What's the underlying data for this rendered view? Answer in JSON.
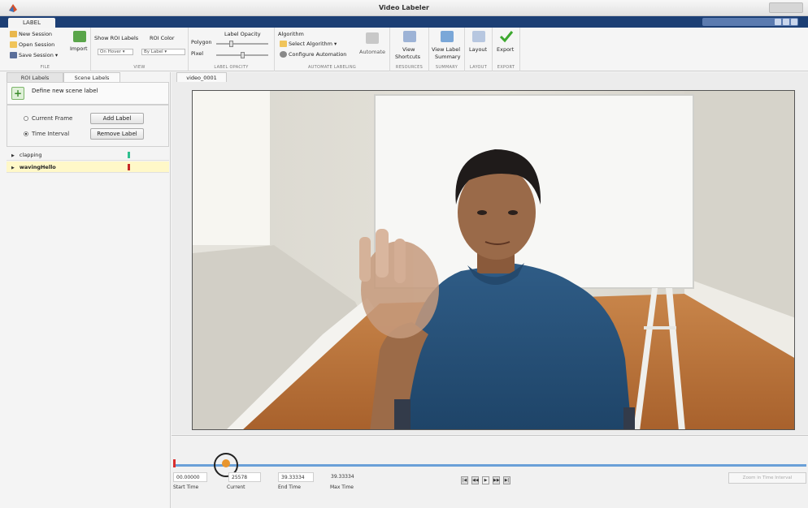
{
  "window": {
    "title": "Video Labeler"
  },
  "tabs": [
    {
      "label": "LABEL"
    }
  ],
  "ribbon": {
    "file": {
      "footer": "FILE",
      "new_session": "New Session",
      "open_session": "Open Session",
      "save_session": "Save Session ▾",
      "import": "Import"
    },
    "view": {
      "footer": "VIEW",
      "show_roi_labels": "Show ROI Labels",
      "show_roi_labels_value": "On Hover ▾",
      "roi_color": "ROI Color",
      "roi_color_value": "By Label ▾"
    },
    "opacity": {
      "footer": "LABEL OPACITY",
      "title": "Label Opacity",
      "polygon": "Polygon",
      "pixel": "Pixel"
    },
    "automate": {
      "footer": "AUTOMATE LABELING",
      "algorithm": "Algorithm",
      "select_algorithm": "Select Algorithm ▾",
      "configure": "Configure Automation",
      "automate": "Automate"
    },
    "resources": {
      "footer": "RESOURCES",
      "view_shortcuts_1": "View",
      "view_shortcuts_2": "Shortcuts"
    },
    "summary": {
      "footer": "SUMMARY",
      "view_label_1": "View Label",
      "view_label_2": "Summary"
    },
    "layout": {
      "footer": "LAYOUT",
      "label": "Layout"
    },
    "export": {
      "footer": "EXPORT",
      "label": "Export"
    }
  },
  "left_panel": {
    "tabs": [
      "ROI Labels",
      "Scene Labels"
    ],
    "define_label": "Define new scene label",
    "current_frame": "Current Frame",
    "time_interval": "Time Interval",
    "add_label": "Add Label",
    "remove_label": "Remove Label",
    "labels": [
      {
        "name": "clapping",
        "color": "#2fbf8f"
      },
      {
        "name": "wavingHello",
        "color": "#c62828"
      }
    ]
  },
  "document": {
    "tab": "video_0001"
  },
  "timeline": {
    "start_time": "00.00000",
    "current_time": "25578",
    "end_time": "39.33334",
    "max_time": "39.33334",
    "start_label": "Start Time",
    "current_label": "Current",
    "end_label": "End Time",
    "max_label": "Max Time",
    "zoom_button": "Zoom in Time Interval",
    "controls": [
      "|◀",
      "◀◀",
      "▶",
      "▶▶",
      "▶|"
    ]
  }
}
